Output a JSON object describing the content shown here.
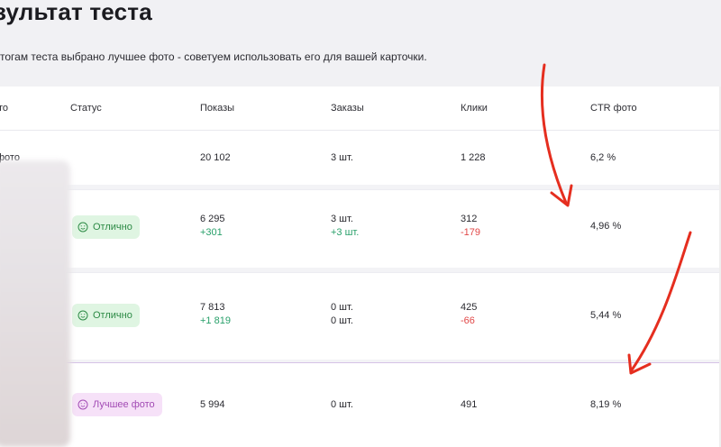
{
  "page": {
    "title": "зультат теста",
    "subtitle": "тогам теста выбрано лучшее фото - советуем использовать его для вашей карточки."
  },
  "table": {
    "headers": {
      "photo": "то",
      "status": "Статус",
      "impressions": "Показы",
      "orders": "Заказы",
      "clicks": "Клики",
      "ctr": "CTR фото"
    },
    "total_row": {
      "photo": "фото",
      "impressions": "20 102",
      "orders": "3 шт.",
      "clicks": "1 228",
      "ctr": "6,2 %"
    },
    "rows": [
      {
        "status": "Отлично",
        "status_kind": "ok",
        "impressions": "6 295",
        "impressions_delta": "+301",
        "orders": "3 шт.",
        "orders_delta": "+3 шт.",
        "clicks": "312",
        "clicks_delta": "-179",
        "ctr": "4,96 %"
      },
      {
        "status": "Отлично",
        "status_kind": "ok",
        "impressions": "7 813",
        "impressions_delta": "+1 819",
        "orders": "0 шт.",
        "orders_delta": "0 шт.",
        "clicks": "425",
        "clicks_delta": "-66",
        "ctr": "5,44 %"
      },
      {
        "status": "Лучшее фото",
        "status_kind": "best",
        "impressions": "5 994",
        "orders": "0 шт.",
        "clicks": "491",
        "ctr": "8,19 %"
      }
    ]
  },
  "colors": {
    "annotation_arrow": "#e52e1f",
    "ok_badge_bg": "#dff5e2",
    "ok_badge_text": "#2c8a45",
    "best_badge_bg": "#f6e1f8",
    "best_badge_text": "#a24bb4",
    "positive_delta": "#28a06a",
    "negative_delta": "#e14848"
  },
  "icons": {
    "status_icon": "smile-icon"
  }
}
